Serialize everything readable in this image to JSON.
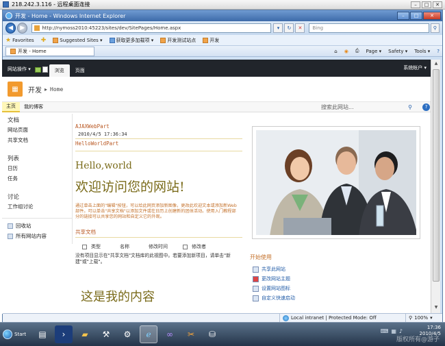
{
  "rdp": {
    "title": "218.242.3.116 - 远程桌面连接"
  },
  "ie": {
    "window_title": "开发 - Home - Windows Internet Explorer",
    "address": "http://nymoss2010:45223/sites/dev/SitePages/Home.aspx",
    "search_placeholder": "Bing",
    "favorites": {
      "favorites_label": "Favorites",
      "suggested_sites": "Suggested Sites ▾",
      "get_more_addons": "获取更多加载项 ▾",
      "dev_test_site": "开发测试站点",
      "dev": "开发"
    },
    "tab_label": "开发 - Home",
    "commands": {
      "page": "Page ▾",
      "safety": "Safety ▾",
      "tools": "Tools ▾",
      "help": "?"
    }
  },
  "ribbon": {
    "site_actions": "网站操作 ▾",
    "browse_tab": "浏览",
    "page_tab": "页面",
    "system_account": "系统帐户 ▾"
  },
  "title_area": {
    "site_title": "开发",
    "separator": "▸",
    "page_name": "Home"
  },
  "topnav": {
    "home": "主页",
    "blog": "我的博客",
    "search_placeholder": "搜索此网站...",
    "help": "?"
  },
  "quicklaunch": {
    "libraries_head": "文档",
    "site_pages": "网站页面",
    "shared_docs": "共享文档",
    "lists_head": "列表",
    "calendar": "日历",
    "tasks": "任务",
    "discussions_head": "讨论",
    "team_discussion": "工作组讨论",
    "recycle_bin": "回收站",
    "all_site_content": "所有网站内容"
  },
  "main": {
    "ajax_webpart_title": "AJAXWebPart",
    "ajax_date": "2010/4/5 17:36:34",
    "hello_webpart_title": "HelloWorldPart",
    "hello_text": "Hello,world",
    "welcome_text": "欢迎访问您的网站!",
    "description": "通过单击上面的\"编辑\"按钮，可以给此网页添加新图像，更改此欢迎文本或添加新Web部件。可以单击\"共享文档\"以添加文件或在日历上创建新的团体活动。使用入门教程部分的链接可以共享您的网站和自定义它的外观。",
    "shared_docs_title": "共享文档",
    "columns": {
      "type": "类型",
      "name": "名称",
      "modified": "修改时间",
      "modified_by": "修改者"
    },
    "empty_message": "没有项目显示在\"共享文档\"文档库的此视图中。若要添加新项目，请单击\"新建\"或\"上载\"。",
    "my_content": "这是我的内容"
  },
  "getting_started": {
    "title": "开始使用",
    "items": [
      "共享此网站",
      "更改网站主题",
      "设置网站图标",
      "自定义快速启动"
    ]
  },
  "status": {
    "zone": "Local intranet | Protected Mode: Off",
    "zoom": "100%"
  },
  "taskbar": {
    "start": "Start",
    "time": "17:36",
    "date": "2010/4/5"
  },
  "watermark": "版权所有@游子",
  "colors": {
    "ribbon_bg": "#21252b",
    "accent_orange": "#c4722c",
    "title_olive": "#7a6b1a",
    "link_blue": "#1f5aa6"
  }
}
